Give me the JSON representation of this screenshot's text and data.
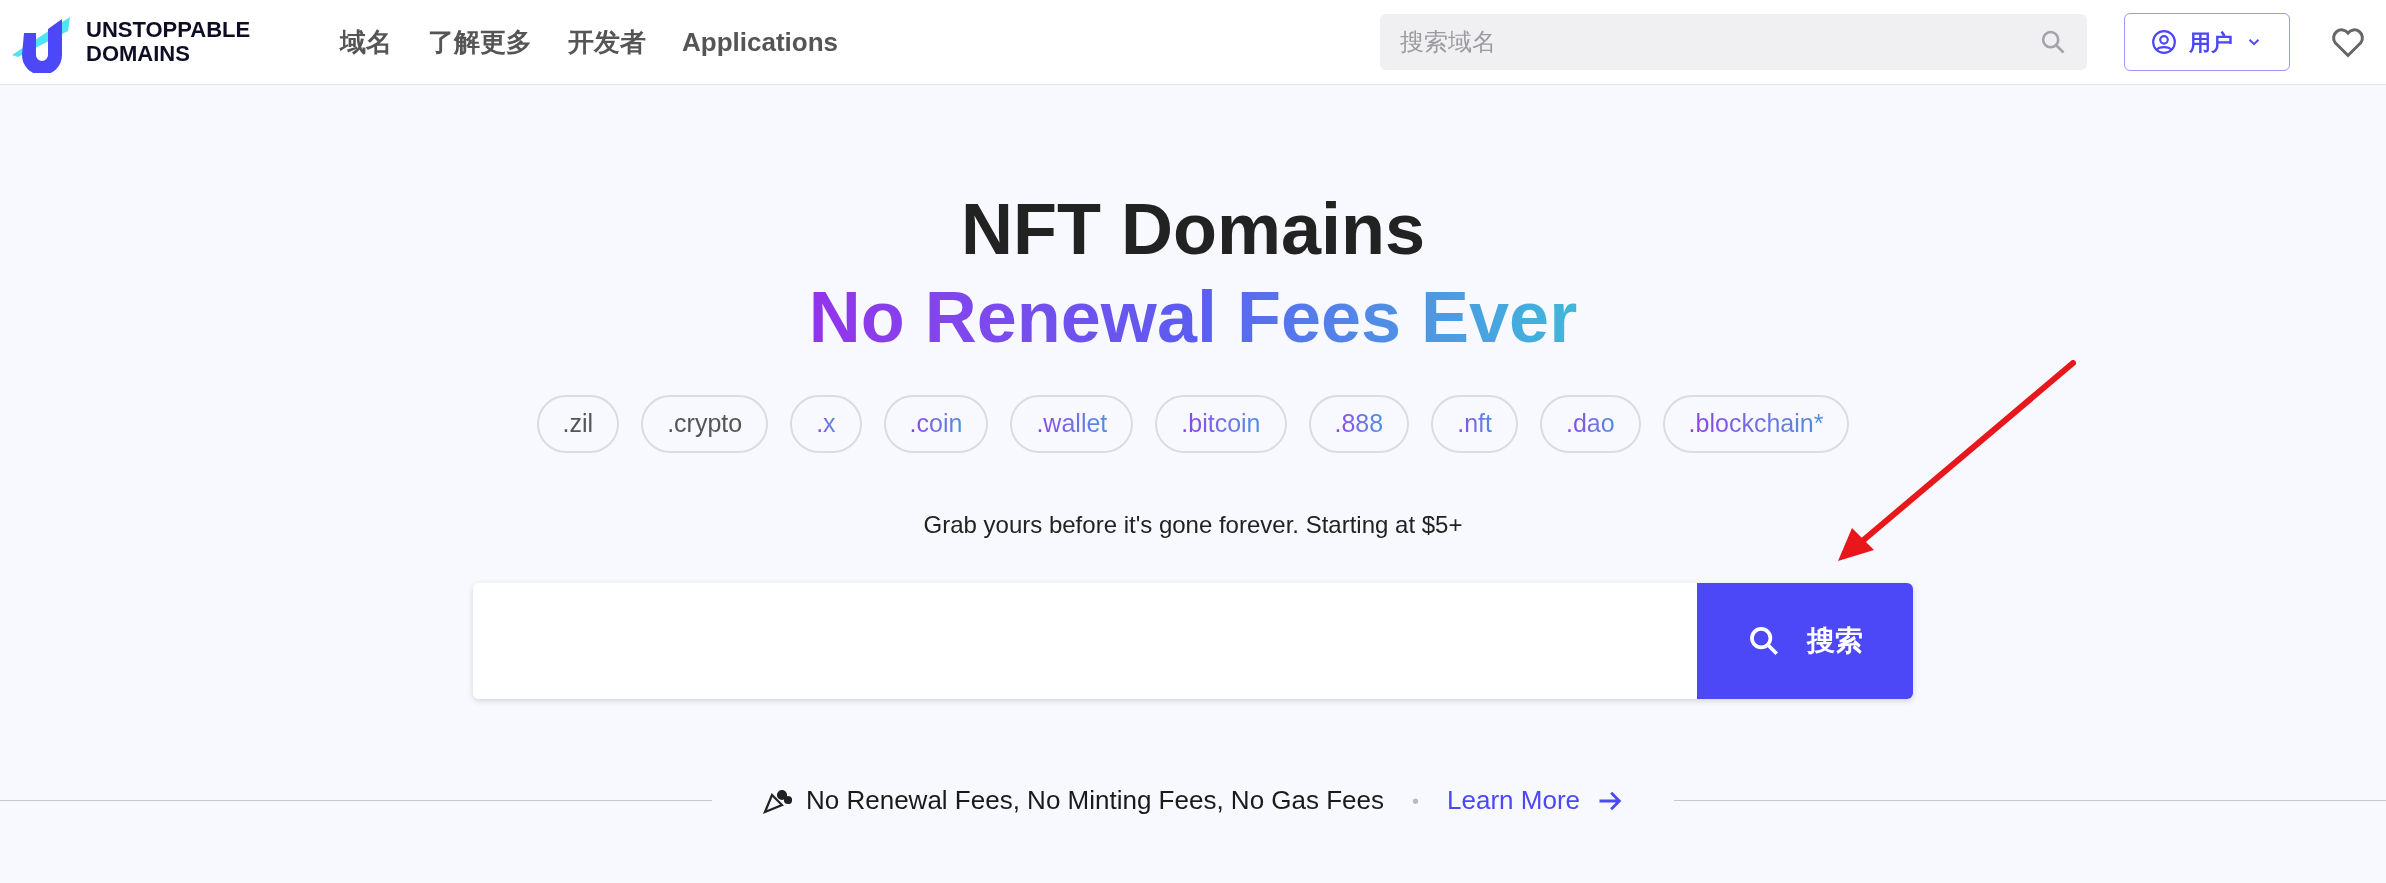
{
  "header": {
    "logo": {
      "line_1": "UNSTOPPABLE",
      "line_2": "DOMAINS"
    },
    "nav": [
      {
        "label": "域名"
      },
      {
        "label": "了解更多"
      },
      {
        "label": "开发者"
      },
      {
        "label": "Applications"
      }
    ],
    "search": {
      "placeholder": "搜索域名"
    },
    "user_button": {
      "label": "用户"
    }
  },
  "hero": {
    "title": "NFT Domains",
    "subtitle": "No Renewal Fees Ever",
    "tags": [
      {
        "label": ".zil",
        "kind": "plain"
      },
      {
        "label": ".crypto",
        "kind": "plain"
      },
      {
        "label": ".x",
        "kind": "gradient"
      },
      {
        "label": ".coin",
        "kind": "gradient"
      },
      {
        "label": ".wallet",
        "kind": "gradient"
      },
      {
        "label": ".bitcoin",
        "kind": "gradient"
      },
      {
        "label": ".888",
        "kind": "gradient"
      },
      {
        "label": ".nft",
        "kind": "gradient"
      },
      {
        "label": ".dao",
        "kind": "gradient"
      },
      {
        "label": ".blockchain*",
        "kind": "gradient"
      }
    ],
    "tagline": "Grab yours before it's gone forever. Starting at $5+",
    "search_button": {
      "label": "搜索"
    }
  },
  "footer_banner": {
    "text": "No Renewal Fees, No Minting Fees, No Gas Fees",
    "separator": "•",
    "link": "Learn More"
  }
}
